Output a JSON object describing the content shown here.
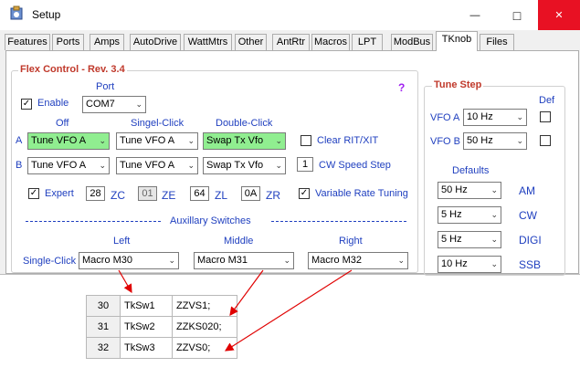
{
  "window": {
    "title": "Setup",
    "minimize": "—",
    "maximize": "□",
    "close": "✕"
  },
  "tabs": [
    "Features",
    "Ports",
    "Amps",
    "AutoDrive",
    "WattMtrs",
    "Other",
    "AntRtr",
    "Macros",
    "LPT",
    "ModBus",
    "TKnob",
    "Files"
  ],
  "active_tab": "TKnob",
  "flex": {
    "title": "Flex Control - Rev. 3.4",
    "help": "?",
    "enable_label": "Enable",
    "enable_checked": true,
    "port_label": "Port",
    "port_value": "COM7",
    "col_off": "Off",
    "col_single": "Singel-Click",
    "col_double": "Double-Click",
    "row_a": "A",
    "row_b": "B",
    "a_off": "Tune VFO A",
    "a_single": "Tune VFO A",
    "a_double": "Swap Tx Vfo",
    "b_off": "Tune VFO A",
    "b_single": "Tune VFO A",
    "b_double": "Swap Tx Vfo",
    "clear_rit_label": "Clear RIT/XIT",
    "cw_speed_value": "1",
    "cw_speed_label": "CW Speed Step",
    "expert_label": "Expert",
    "zc_value": "28",
    "zc_label": "ZC",
    "ze_value": "01",
    "ze_label": "ZE",
    "zl_value": "64",
    "zl_label": "ZL",
    "zr_value": "0A",
    "zr_label": "ZR",
    "vrt_label": "Variable Rate Tuning",
    "aux_title": "Auxillary Switches",
    "aux_left": "Left",
    "aux_middle": "Middle",
    "aux_right": "Right",
    "single_click_label": "Single-Click",
    "sw_left": "Macro M30",
    "sw_middle": "Macro M31",
    "sw_right": "Macro M32"
  },
  "tune": {
    "title": "Tune Step",
    "def_label": "Def",
    "vfo_a_label": "VFO A",
    "vfo_a_value": "10 Hz",
    "vfo_b_label": "VFO B",
    "vfo_b_value": "50 Hz",
    "defaults_label": "Defaults",
    "modes": [
      {
        "value": "50 Hz",
        "label": "AM"
      },
      {
        "value": "5 Hz",
        "label": "CW"
      },
      {
        "value": "5 Hz",
        "label": "DIGI"
      },
      {
        "value": "10 Hz",
        "label": "SSB"
      }
    ]
  },
  "macro_table": [
    {
      "num": "30",
      "name": "TkSw1",
      "cmd": "ZZVS1;"
    },
    {
      "num": "31",
      "name": "TkSw2",
      "cmd": "ZZKS020;"
    },
    {
      "num": "32",
      "name": "TkSw3",
      "cmd": "ZZVS0;"
    }
  ],
  "colors": {
    "accent_red": "#c0392b",
    "label_blue": "#1f3fbf",
    "highlight_green": "#90ee90",
    "arrow_red": "#e00000"
  }
}
